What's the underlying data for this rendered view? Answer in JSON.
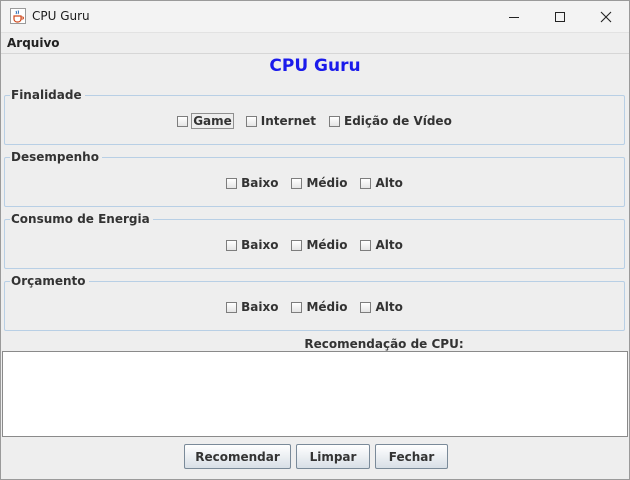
{
  "window": {
    "title": "CPU Guru",
    "icons": {
      "app": "java-cup-icon",
      "minimize": "minimize-icon",
      "maximize": "maximize-icon",
      "close": "close-icon"
    }
  },
  "menu": {
    "items": [
      {
        "label": "Arquivo"
      }
    ]
  },
  "heading": {
    "text": "CPU Guru",
    "color": "#1a1aeb"
  },
  "groups": [
    {
      "title": "Finalidade",
      "options": [
        {
          "label": "Game",
          "checked": false
        },
        {
          "label": "Internet",
          "checked": false
        },
        {
          "label": "Edição de Vídeo",
          "checked": false
        }
      ]
    },
    {
      "title": "Desempenho",
      "options": [
        {
          "label": "Baixo",
          "checked": false
        },
        {
          "label": "Médio",
          "checked": false
        },
        {
          "label": "Alto",
          "checked": false
        }
      ]
    },
    {
      "title": "Consumo de Energia",
      "options": [
        {
          "label": "Baixo",
          "checked": false
        },
        {
          "label": "Médio",
          "checked": false
        },
        {
          "label": "Alto",
          "checked": false
        }
      ]
    },
    {
      "title": "Orçamento",
      "options": [
        {
          "label": "Baixo",
          "checked": false
        },
        {
          "label": "Médio",
          "checked": false
        },
        {
          "label": "Alto",
          "checked": false
        }
      ]
    }
  ],
  "result": {
    "label": "Recomendação de CPU:",
    "value": ""
  },
  "buttons": {
    "recommend": "Recomendar",
    "clear": "Limpar",
    "close": "Fechar"
  }
}
